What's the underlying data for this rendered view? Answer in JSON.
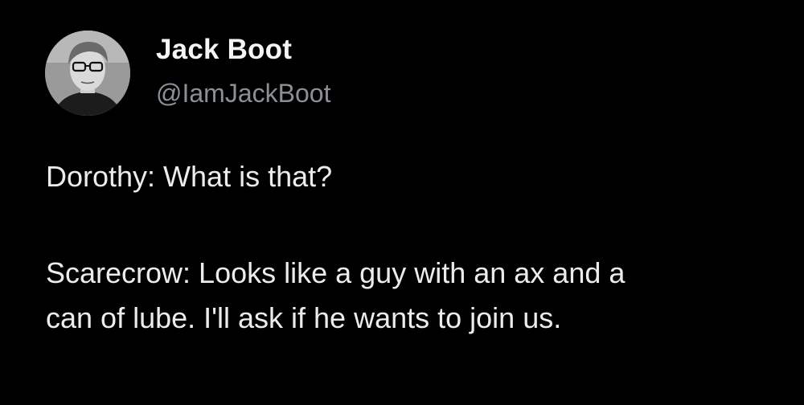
{
  "tweet": {
    "author": {
      "display_name": "Jack Boot",
      "handle": "@IamJackBoot",
      "avatar_icon": "profile-photo"
    },
    "lines": [
      "Dorothy: What is that?",
      "Scarecrow: Looks like a guy with an ax and a",
      "can of lube. I'll ask if he wants to join us."
    ]
  },
  "colors": {
    "background": "#000000",
    "name": "#f5f5f5",
    "handle": "#8b9096",
    "text": "#ececec"
  }
}
